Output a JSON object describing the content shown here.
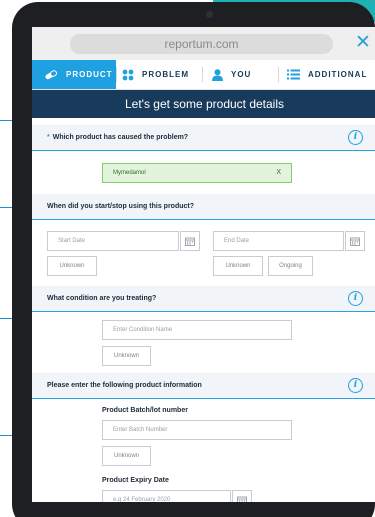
{
  "browser": {
    "url": "reportum.com",
    "close_symbol": "✕"
  },
  "nav": {
    "items": [
      {
        "label": "PRODUCT",
        "icon": "pill-icon",
        "active": true
      },
      {
        "label": "PROBLEM",
        "icon": "problem-grid-icon",
        "active": false
      },
      {
        "label": "YOU",
        "icon": "person-icon",
        "active": false
      },
      {
        "label": "ADDITIONAL",
        "icon": "list-icon",
        "active": false
      }
    ]
  },
  "heading": "Let's get some product details",
  "sections": {
    "product": {
      "required_mark": "*",
      "question": "Which product has caused the problem?",
      "selected_value": "Mymedamol",
      "remove_label": "X"
    },
    "dates": {
      "question": "When did you start/stop using this product?",
      "start_placeholder": "Start Date",
      "end_placeholder": "End Date",
      "unknown_start": "Unknown",
      "unknown_end": "Unknown",
      "ongoing": "Ongoing"
    },
    "condition": {
      "question": "What condition are you treating?",
      "placeholder": "Enter Condition Name",
      "unknown": "Unknown"
    },
    "product_info": {
      "question": "Please enter the following product information",
      "batch_label": "Product Batch/lot number",
      "batch_placeholder": "Enter Batch Number",
      "batch_unknown": "Unknown",
      "expiry_label": "Product Expiry Date",
      "expiry_placeholder": "e.g 24 February 2020"
    }
  },
  "colors": {
    "accent": "#1fa0e0",
    "navy": "#183b5c",
    "success_bg": "#e2f5dc",
    "teal": "#1fb1b3"
  }
}
